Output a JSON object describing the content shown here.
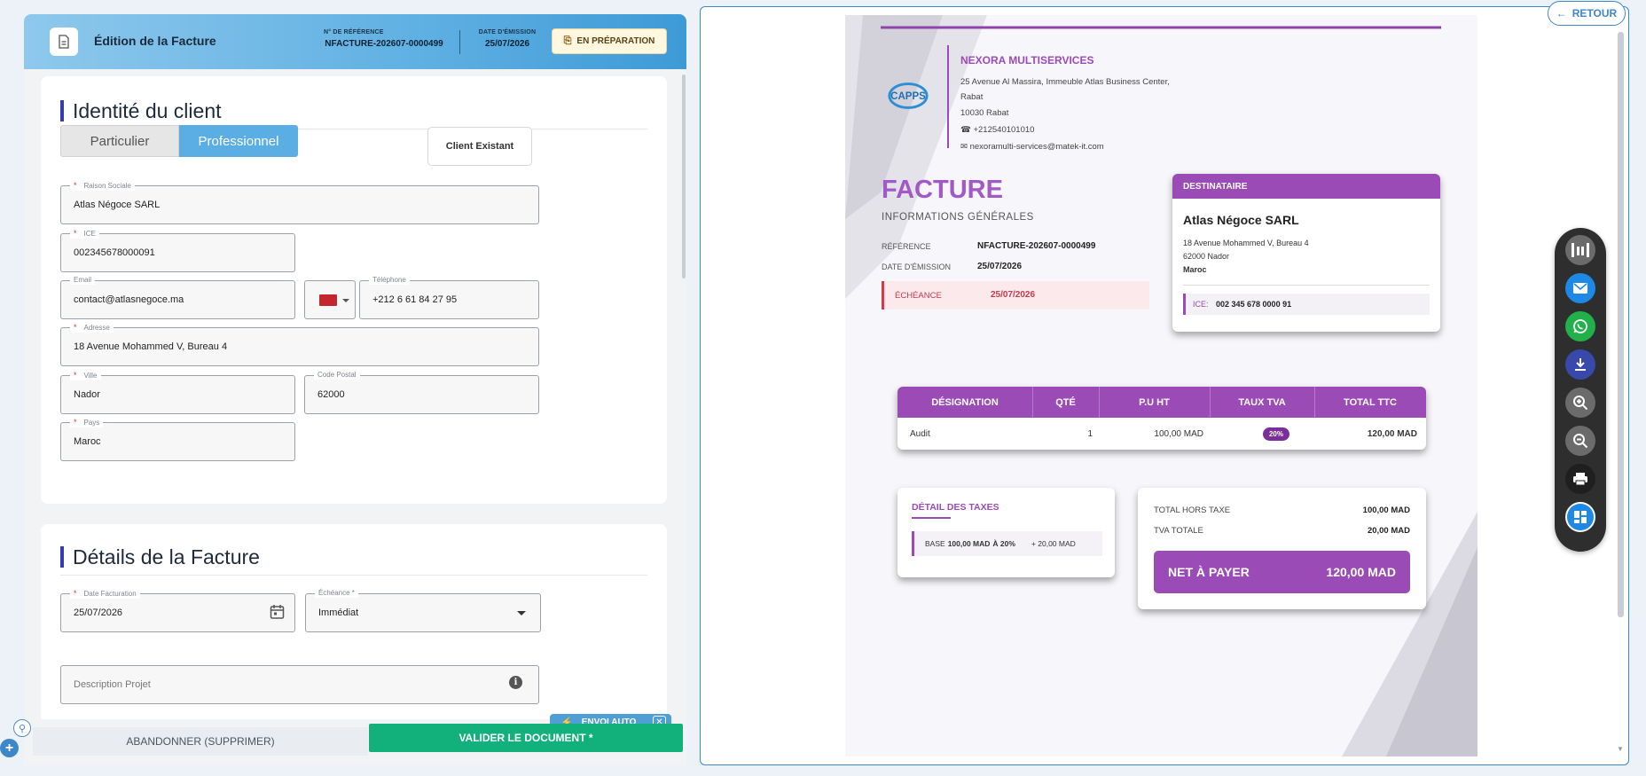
{
  "header": {
    "title": "Édition de la Facture",
    "ref_label": "N° DE RÉFÉRENCE",
    "ref_value": "NFACTURE-202607-0000499",
    "date_label": "DATE D'ÉMISSION",
    "date_value": "25/07/2026",
    "status": "EN PRÉPARATION"
  },
  "client": {
    "section_title": "Identité du client",
    "type_particulier": "Particulier",
    "type_professionnel": "Professionnel",
    "existing_btn": "Client Existant",
    "raison_label": "Raison Sociale",
    "raison_value": "Atlas Négoce SARL",
    "ice_label": "ICE",
    "ice_value": "002345678000091",
    "email_label": "Email",
    "email_value": "contact@atlasnegoce.ma",
    "tel_label": "Téléphone",
    "tel_value": "+212 6 61 84 27 95",
    "adresse_label": "Adresse",
    "adresse_value": "18 Avenue Mohammed V, Bureau 4",
    "ville_label": "Ville",
    "ville_value": "Nador",
    "cp_label": "Code Postal",
    "cp_value": "62000",
    "pays_label": "Pays",
    "pays_value": "Maroc"
  },
  "details": {
    "section_title": "Détails de la Facture",
    "date_label": "Date Facturation",
    "date_value": "25/07/2026",
    "echeance_label": "Échéance *",
    "echeance_value": "Immédiat",
    "desc_placeholder": "Description Projet"
  },
  "actions": {
    "envoi_auto": "ENVOI AUTO",
    "abandon": "ABANDONNER (SUPPRIMER)",
    "valider": "VALIDER LE DOCUMENT *"
  },
  "preview": {
    "retour": "RETOUR",
    "company": {
      "name": "NEXORA MULTISERVICES",
      "addr1": "25 Avenue Al Massira, Immeuble Atlas Business Center,",
      "addr2": "Rabat",
      "addr3": "10030 Rabat",
      "phone": "☎ +212540101010",
      "email": "✉ nexoramulti-services@matek-it.com",
      "logo": "CAPPS"
    },
    "doc_title": "FACTURE",
    "info_title": "INFORMATIONS GÉNÉRALES",
    "ref_label": "RÉFÉRENCE",
    "ref_value": "NFACTURE-202607-0000499",
    "date_label": "DATE D'ÉMISSION",
    "date_value": "25/07/2026",
    "echeance_label": "ÉCHÉANCE",
    "echeance_value": "25/07/2026",
    "dest": {
      "title": "DESTINATAIRE",
      "name": "Atlas Négoce SARL",
      "addr1": "18 Avenue Mohammed V, Bureau 4",
      "addr2": "62000 Nador",
      "country": "Maroc",
      "ice_label": "ICE:",
      "ice_value": "002 345 678 0000 91"
    },
    "table": {
      "headers": [
        "DÉSIGNATION",
        "QTÉ",
        "P.U HT",
        "TAUX TVA",
        "TOTAL TTC"
      ],
      "row": {
        "designation": "Audit",
        "qte": "1",
        "pu": "100,00 MAD",
        "tva": "20%",
        "total": "120,00 MAD"
      }
    },
    "taxes": {
      "title": "DÉTAIL DES TAXES",
      "base_prefix": "BASE",
      "base_amount": "100,00 MAD",
      "base_suffix": "À 20%",
      "base_tax": "+ 20,00 MAD"
    },
    "totals": {
      "ht_label": "TOTAL HORS TAXE",
      "ht_value": "100,00 MAD",
      "tva_label": "TVA TOTALE",
      "tva_value": "20,00 MAD",
      "net_label": "NET À PAYER",
      "net_value": "120,00 MAD"
    }
  },
  "colors": {
    "primary": "#9b4bb5",
    "valider": "#12b07a",
    "accent_blue": "#3d87c9"
  }
}
